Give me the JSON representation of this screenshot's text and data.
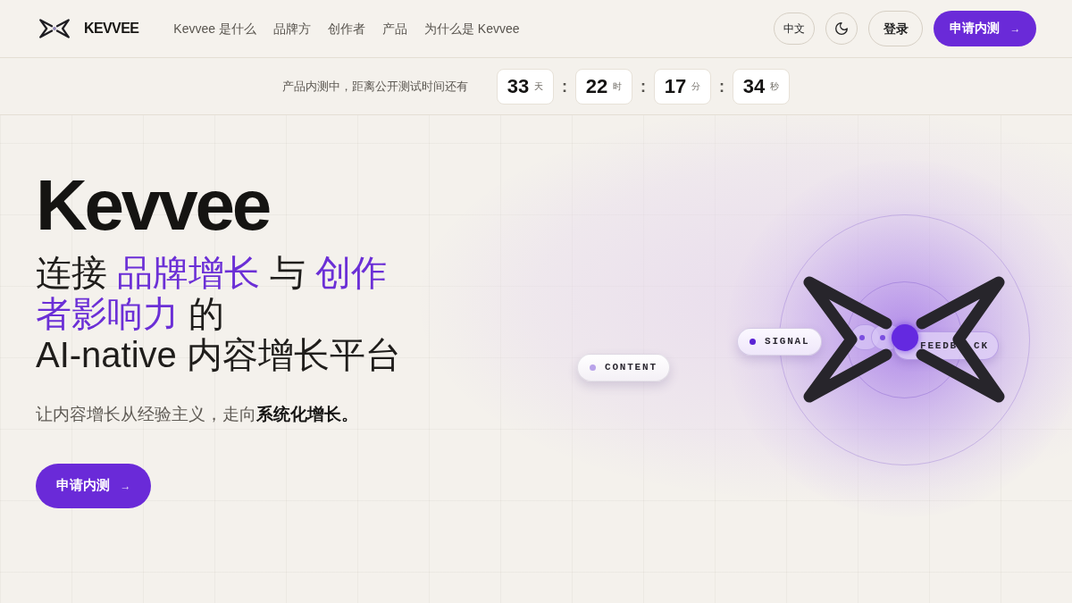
{
  "navbar": {
    "brand": "KEVVEE",
    "links": [
      "Kevvee 是什么",
      "品牌方",
      "创作者",
      "产品",
      "为什么是 Kevvee"
    ],
    "language": "中文",
    "login": "登录",
    "cta": {
      "label": "申请内测",
      "arrow": "→"
    }
  },
  "countdown": {
    "lead": "产品内测中，距离公开测试时间还有",
    "units": [
      {
        "value": "33",
        "unit": "天",
        "separator": ":"
      },
      {
        "value": "22",
        "unit": "时",
        "separator": ":"
      },
      {
        "value": "17",
        "unit": "分",
        "separator": ":"
      },
      {
        "value": "34",
        "unit": "秒"
      }
    ]
  },
  "hero": {
    "title": "Kevvee",
    "headline_lines": [
      [
        {
          "text": "连接 ",
          "highlight": false
        },
        {
          "text": "品牌增长",
          "highlight": true
        },
        {
          "text": " 与 ",
          "highlight": false
        },
        {
          "text": "创作",
          "highlight": true
        }
      ],
      [
        {
          "text": "者影响力",
          "highlight": true
        },
        {
          "text": " 的",
          "highlight": false
        }
      ],
      [
        {
          "text": "AI-native 内容增长平台",
          "highlight": false
        }
      ]
    ],
    "subtitle": "让内容增长从经验主义，走向**系统化增长。**",
    "cta": {
      "label": "申请内测",
      "arrow": "→"
    }
  },
  "diagram": {
    "pills": [
      {
        "kind": "plain",
        "label_parts": [
          "CONTENT"
        ],
        "color": "#b9a3ea"
      },
      {
        "kind": "tinted",
        "label_parts": [
          "SIGNAL"
        ],
        "color": "#5a22d4"
      },
      {
        "kind": "glass",
        "label_parts": [
          "FEEDB",
          "CK"
        ]
      }
    ]
  }
}
